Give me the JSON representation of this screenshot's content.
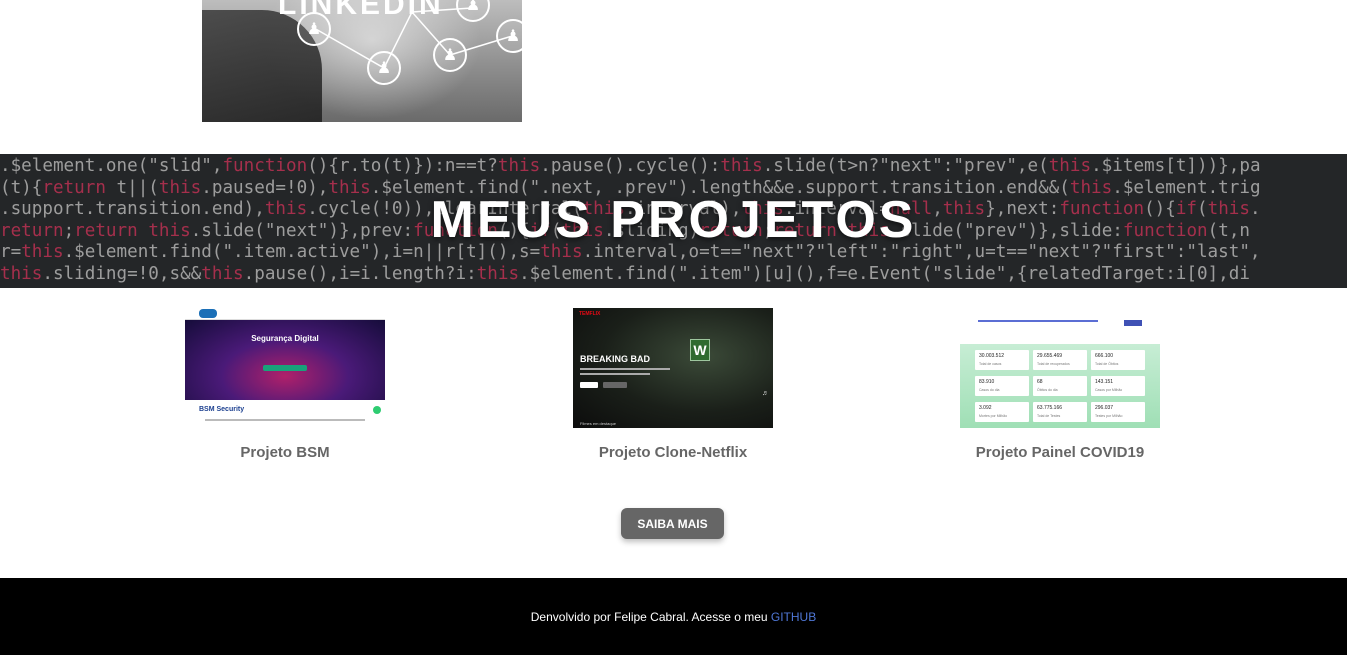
{
  "linkedin_card": {
    "title": "LINKEDIN"
  },
  "projects_banner": {
    "title": "MEUS PROJETOS",
    "code_lines": [
      ".$element.one(\"slid\",function(){r.to(t)}):n==t?this.pause().cycle():this.slide(t>n?\"next\":\"prev\",e(this.$items[t]))},pa",
      "(t){return t||(this.paused=!0),this.$element.find(\".next, .prev\").length&&e.support.transition.end&&(this.$element.trig",
      ".support.transition.end),this.cycle(!0)),clearInterval(this.interval),this.interval=null,this},next:function(){if(this.",
      "return;return this.slide(\"next\")},prev:function(){if(this.sliding)return;return this.slide(\"prev\")},slide:function(t,n",
      "r=this.$element.find(\".item.active\"),i=n||r[t](),s=this.interval,o=t==\"next\"?\"left\":\"right\",u=t==\"next\"?\"first\":\"last\",",
      "this.sliding=!0,s&&this.pause(),i=i.length?i:this.$element.find(\".item\")[u](),f=e.Event(\"slide\",{relatedTarget:i[0],di"
    ]
  },
  "projects": [
    {
      "name": "Projeto BSM",
      "thumb": {
        "hero_title": "Segurança Digital",
        "section_title": "BSM Security"
      }
    },
    {
      "name": "Projeto Clone-Netflix",
      "thumb": {
        "brand": "TEMFLIX",
        "show_title": "BREAKING BAD",
        "badge": "W",
        "row_title": "Filmes em destaque"
      }
    },
    {
      "name": "Projeto Painel COVID19",
      "thumb": {
        "stats": [
          {
            "value": "30.003.512",
            "label": "Total de casos"
          },
          {
            "value": "29.655.469",
            "label": "Total de recuperados"
          },
          {
            "value": "666.100",
            "label": "Total de Óbitos"
          },
          {
            "value": "83.910",
            "label": "Casos do dia"
          },
          {
            "value": "68",
            "label": "Óbitos do dia"
          },
          {
            "value": "143.151",
            "label": "Casos por Milhão"
          },
          {
            "value": "3.092",
            "label": "Mortes por Milhão"
          },
          {
            "value": "63.775.166",
            "label": "Total de Testes"
          },
          {
            "value": "296.037",
            "label": "Testes por Milhão"
          }
        ]
      }
    }
  ],
  "cta": {
    "label": "SAIBA MAIS"
  },
  "footer": {
    "text": "Denvolvido por Felipe Cabral. Acesse o meu ",
    "link_label": "GITHUB"
  },
  "colors": {
    "footer_bg": "#000000",
    "link": "#4f77d6",
    "button_bg": "#666666",
    "code_keyword": "#c2385a"
  }
}
